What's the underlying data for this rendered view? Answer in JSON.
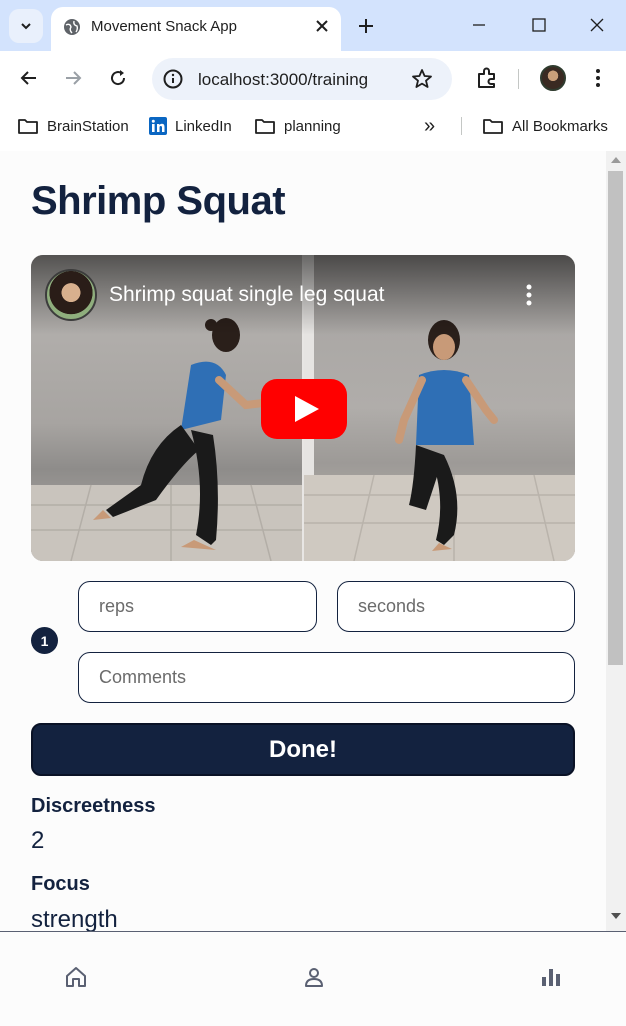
{
  "browser": {
    "tab_title": "Movement Snack App",
    "url": "localhost:3000/training",
    "bookmarks": [
      {
        "label": "BrainStation",
        "icon": "folder-icon"
      },
      {
        "label": "LinkedIn",
        "icon": "linkedin-icon"
      },
      {
        "label": "planning",
        "icon": "folder-icon"
      }
    ],
    "all_bookmarks": "All Bookmarks",
    "overflow": "»"
  },
  "page": {
    "title": "Shrimp Squat",
    "video": {
      "title": "Shrimp squat single leg squat"
    },
    "set": {
      "number": "1",
      "reps_placeholder": "reps",
      "seconds_placeholder": "seconds",
      "comments_placeholder": "Comments"
    },
    "done_label": "Done!",
    "info": [
      {
        "label": "Discreetness",
        "value": "2"
      },
      {
        "label": "Focus",
        "value": "strength"
      }
    ]
  },
  "bottom_nav": {
    "items": [
      "home-icon",
      "profile-icon",
      "stats-icon"
    ]
  },
  "colors": {
    "primary": "#13223f",
    "tabbar": "#d3e3fd",
    "youtube_red": "#ff0000"
  }
}
